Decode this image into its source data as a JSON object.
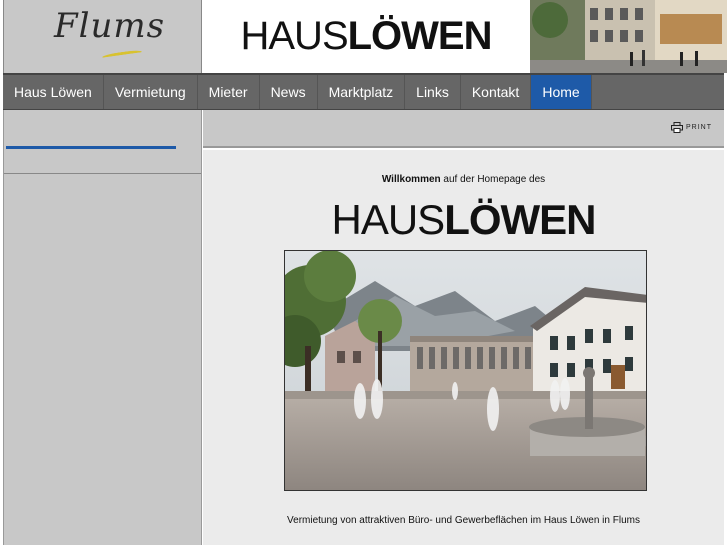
{
  "header": {
    "flums_logo_text": "Flums",
    "brand_thin": "HAUS",
    "brand_bold": "LÖWEN"
  },
  "nav": {
    "items": [
      {
        "label": "Haus Löwen"
      },
      {
        "label": "Vermietung"
      },
      {
        "label": "Mieter"
      },
      {
        "label": "News"
      },
      {
        "label": "Marktplatz"
      },
      {
        "label": "Links"
      },
      {
        "label": "Kontakt"
      },
      {
        "label": "Home"
      }
    ],
    "active": "Home"
  },
  "toolbar": {
    "print_label": "PRINT"
  },
  "main": {
    "welcome_bold": "Willkommen",
    "welcome_rest": " auf der Homepage des",
    "brand_thin": "HAUS",
    "brand_bold": "LÖWEN",
    "caption": "Vermietung von attraktiven Büro- und Gewerbeflächen im Haus Löwen in Flums"
  },
  "colors": {
    "accent": "#1e5aa8",
    "nav_bg": "#666666",
    "sidebar_bg": "#c8c8c8",
    "main_bg": "#ebebeb"
  }
}
